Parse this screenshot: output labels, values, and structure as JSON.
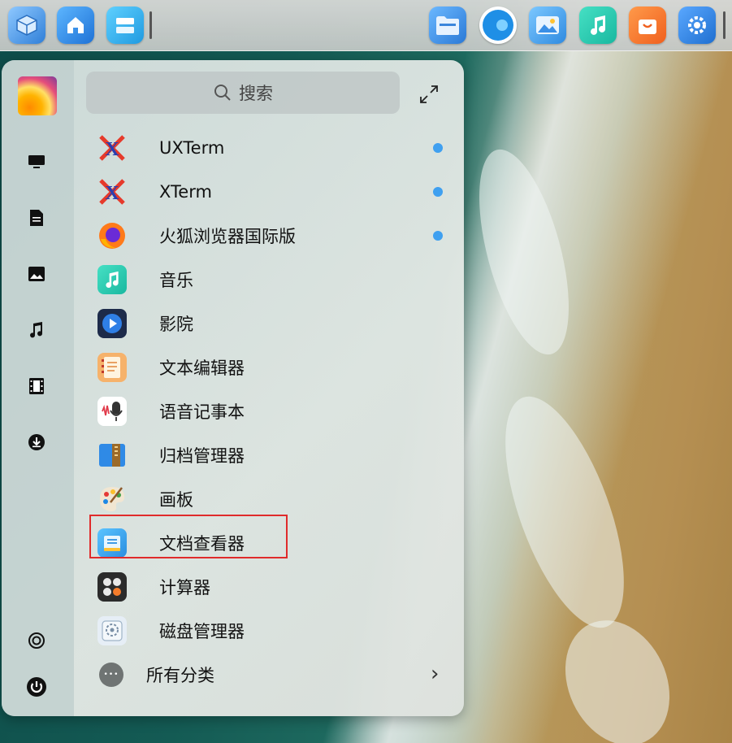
{
  "dock": {
    "icons": [
      {
        "name": "launcher-cube-icon",
        "color": "#4a9ae8"
      },
      {
        "name": "home-folder-icon",
        "color": "#3a8fe6"
      },
      {
        "name": "multitask-view-icon",
        "color": "#2aa8e8"
      },
      {
        "name": "file-manager-icon",
        "color": "#3a86dc"
      },
      {
        "name": "browser-icon",
        "color": "#1f8fe6"
      },
      {
        "name": "image-viewer-icon",
        "color": "#3aa0e8"
      },
      {
        "name": "music-icon",
        "color": "#2fd1b0"
      },
      {
        "name": "app-store-icon",
        "color": "#f57c2b"
      },
      {
        "name": "settings-icon",
        "color": "#2c7fdc"
      }
    ]
  },
  "menu": {
    "search_placeholder": "搜索",
    "apps": [
      {
        "label": "UXTerm",
        "icon": "xterm-icon",
        "new": true
      },
      {
        "label": "XTerm",
        "icon": "xterm-icon",
        "new": true
      },
      {
        "label": "火狐浏览器国际版",
        "icon": "firefox-icon",
        "new": true
      },
      {
        "label": "音乐",
        "icon": "music-note-icon",
        "new": false
      },
      {
        "label": "影院",
        "icon": "movie-player-icon",
        "new": false
      },
      {
        "label": "文本编辑器",
        "icon": "text-editor-icon",
        "new": false
      },
      {
        "label": "语音记事本",
        "icon": "voice-note-icon",
        "new": false
      },
      {
        "label": "归档管理器",
        "icon": "archive-manager-icon",
        "new": false
      },
      {
        "label": "画板",
        "icon": "paint-palette-icon",
        "new": false
      },
      {
        "label": "文档查看器",
        "icon": "document-viewer-icon",
        "new": false
      },
      {
        "label": "计算器",
        "icon": "calculator-icon",
        "new": false
      },
      {
        "label": "磁盘管理器",
        "icon": "disk-manager-icon",
        "new": false
      }
    ],
    "all_categories_label": "所有分类",
    "more_dots": "•••",
    "chevron": "›"
  },
  "colors": {
    "new_dot": "#3fa0f0",
    "highlight_border": "#e02b2b"
  }
}
